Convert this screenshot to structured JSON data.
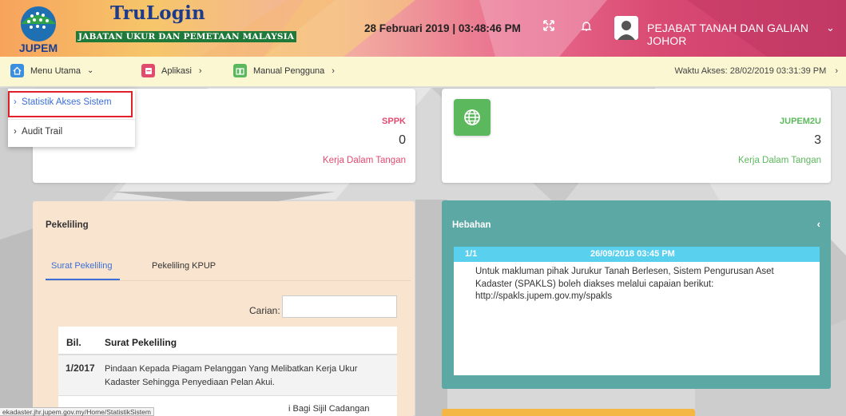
{
  "header": {
    "logo_text": "JUPEM",
    "brand_title": "TruLogin",
    "brand_subtitle": "JABATAN UKUR DAN PEMETAAN MALAYSIA",
    "datetime": "28 Februari 2019 | 03:48:46 PM",
    "office": "PEJABAT TANAH DAN GALIAN JOHOR"
  },
  "menubar": {
    "menu_utama": "Menu Utama",
    "aplikasi": "Aplikasi",
    "manual": "Manual Pengguna",
    "access_time": "Waktu Akses: 28/02/2019 03:31:39 PM"
  },
  "dropdown": {
    "items": [
      {
        "label": "Statistik Akses Sistem"
      },
      {
        "label": "Audit Trail"
      }
    ]
  },
  "cards": {
    "sppk": {
      "label": "SPPK",
      "count": "0",
      "sub": "Kerja Dalam Tangan",
      "color": "#e24a6e"
    },
    "jupem2u": {
      "label": "JUPEM2U",
      "count": "3",
      "sub": "Kerja Dalam Tangan",
      "color": "#5cb85c"
    }
  },
  "pekeliling": {
    "title": "Pekeliling",
    "tabs": [
      "Surat Pekeliling",
      "Pekeliling KPUP"
    ],
    "search_label": "Carian:",
    "columns": [
      "Bil.",
      "Surat Pekeliling"
    ],
    "rows": [
      {
        "bil": "1/2017",
        "text": "Pindaan Kepada Piagam Pelanggan Yang Melibatkan Kerja Ukur Kadaster Sehingga Penyediaan Pelan Akui."
      },
      {
        "bil": "",
        "text": "i Bagi Sijil Cadangan"
      }
    ]
  },
  "hebahan": {
    "title": "Hebahan",
    "counter": "1/1",
    "date": "26/09/2018 03:45 PM",
    "message": "Untuk makluman pihak Jurukur Tanah Berlesen, Sistem Pengurusan Aset Kadaster (SPAKLS) boleh diakses melalui capaian berikut: http://spakls.jupem.gov.my/spakls"
  },
  "statusbar": {
    "url": "ekadaster.jhr.jupem.gov.my/Home/StatistikSistem"
  }
}
